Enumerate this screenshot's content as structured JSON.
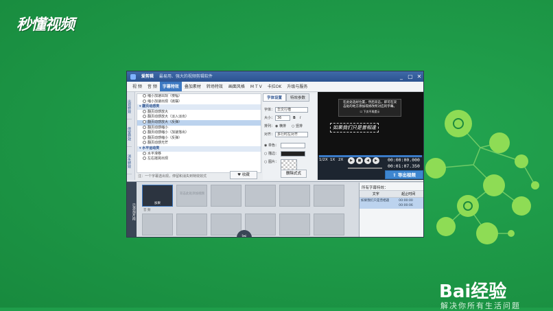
{
  "watermark": {
    "logo_text": "秒懂视频",
    "brand": "Bai经验",
    "brand_sub": "解决你所有生活问题"
  },
  "window": {
    "app_name": "爱剪辑",
    "title_suffix": "最易用、强大的视频剪辑软件",
    "controls": [
      "_",
      "▢",
      "✕"
    ]
  },
  "tabs": [
    "视 频",
    "音 频",
    "字幕特效",
    "叠加素材",
    "转场特效",
    "画面风格",
    "M T V",
    "卡拉OK",
    "升级与服务"
  ],
  "active_tab": "字幕特效",
  "side_tabs": [
    "出现特效",
    "停留特效",
    "消失特效"
  ],
  "effects_list": [
    {
      "label": "缩小加速出现（慢幅）",
      "type": "item"
    },
    {
      "label": "缩小加速出现（抛摆）",
      "type": "item"
    },
    {
      "label": "翻页动感类",
      "type": "group"
    },
    {
      "label": "翻页动感放大",
      "type": "item"
    },
    {
      "label": "翻页动感放大（淡入淡出）",
      "type": "item"
    },
    {
      "label": "翻页动感放大（反弹）",
      "type": "selected"
    },
    {
      "label": "翻页动感缩小",
      "type": "item"
    },
    {
      "label": "翻页动感缩小（加速落出）",
      "type": "item"
    },
    {
      "label": "翻页动感缩小（反弹）",
      "type": "item"
    },
    {
      "label": "翻页动感光芒",
      "type": "item"
    },
    {
      "label": "水平运动类",
      "type": "group"
    },
    {
      "label": "水平滑移",
      "type": "item"
    },
    {
      "label": "左右摇晃出现",
      "type": "item"
    }
  ],
  "hint": "注：一个字幕选出现，停留和消失到特效效式",
  "fav_button": "收藏",
  "props": {
    "tabs": [
      "字体设置",
      "特效参数"
    ],
    "font_label": "字体：",
    "font_value": "华文行楷",
    "size_label": "大小：",
    "size_value": "36",
    "bold": "B",
    "italic": "I",
    "layout_label": "排列：",
    "layout_h": "横排",
    "layout_v": "竖排",
    "align_label": "对齐：",
    "align_value": "多行时左对齐",
    "color_label": "单色：",
    "stroke_label": "描边：",
    "image_label": "图片：",
    "apply_button": "删除式式"
  },
  "preview": {
    "box_text": "在此处选好位置，然后双击，即可在双击处的地方添加或修改所对应的字幕。",
    "box_checkbox": "下次不再提示",
    "subtitle": "如果我们只是曾相逢"
  },
  "controls": {
    "speeds": [
      "1/2X",
      "1X",
      "2X"
    ],
    "time_current": "00:00:00.000",
    "time_total": "00:01:07.350",
    "export": "导出视频"
  },
  "timeline": {
    "side_label": "已添加片段",
    "first_clip_label": "加果",
    "ghost_hint": "双击此处添加视频",
    "audio_track_label": "音 频",
    "cut_icon": "✂"
  },
  "subtitle_panel": {
    "title": "所有字幕特效：",
    "col_text": "文字",
    "col_time": "起止时间",
    "row_text": "如果我们只是曾相逢",
    "row_start": "00:00:00",
    "row_end": "00:00:06"
  },
  "colors": {
    "background": "#1f9d4a",
    "accent": "#3d79c2",
    "title_bar": "#2c5390"
  }
}
